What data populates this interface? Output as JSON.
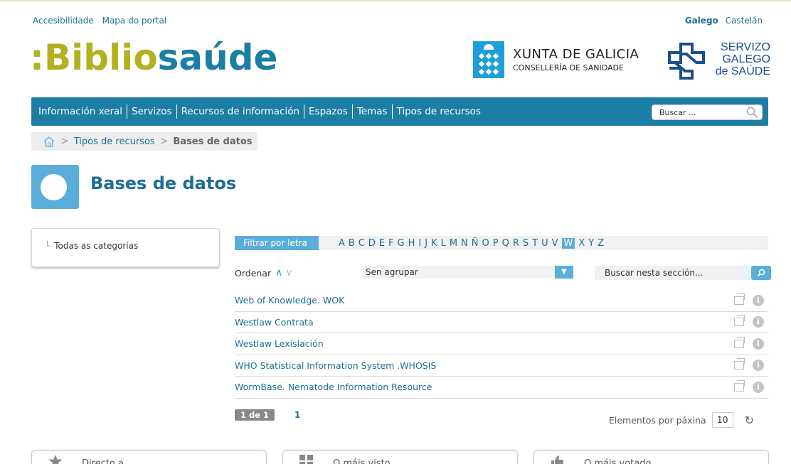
{
  "header": {
    "util_links": [
      "Accesibilidade",
      "Mapa do portal"
    ],
    "languages": {
      "active": "Galego",
      "other": "Castelán"
    },
    "logo": {
      "part1": "Biblio",
      "part2": "saúde"
    },
    "xunta": {
      "line1": "XUNTA DE GALICIA",
      "line2": "CONSELLERÍA DE SANIDADE"
    },
    "sergas": {
      "line1": "SERVIZO",
      "line2": "GALEGO",
      "line3": "de SAÚDE"
    }
  },
  "nav": {
    "items": [
      "Información xeral",
      "Servizos",
      "Recursos de información",
      "Espazos",
      "Temas",
      "Tipos de recursos"
    ],
    "search_placeholder": "Buscar ..."
  },
  "breadcrumb": {
    "items": [
      "Tipos de recursos",
      "Bases de datos"
    ]
  },
  "page": {
    "title": "Bases de datos"
  },
  "sidebar": {
    "item": "Todas as categorías"
  },
  "filter": {
    "label": "Filtrar por letra",
    "letters": [
      "A",
      "B",
      "C",
      "D",
      "E",
      "F",
      "G",
      "H",
      "I",
      "J",
      "K",
      "L",
      "M",
      "N",
      "Ñ",
      "O",
      "P",
      "Q",
      "R",
      "S",
      "T",
      "U",
      "V",
      "W",
      "X",
      "Y",
      "Z"
    ],
    "selected": "W"
  },
  "controls": {
    "sort_label": "Ordenar",
    "group_value": "Sen agrupar",
    "section_search_placeholder": "Buscar nesta sección..."
  },
  "results": [
    "Web of Knowledge. WOK",
    "Westlaw Contrata",
    "Westlaw Lexislación",
    "WHO Statistical Information System .WHOSIS",
    "WormBase. Nematode Information Resource"
  ],
  "pager": {
    "badge": "1 de 1",
    "page": "1",
    "per_page_label": "Elementos por páxina",
    "per_page_value": "10"
  },
  "bottom_tabs": [
    "Directo a",
    "O máis visto",
    "O máis votado"
  ],
  "colors": {
    "brand_blue": "#1c7ea4",
    "brand_olive": "#b3b022",
    "accent": "#5aaed9"
  }
}
